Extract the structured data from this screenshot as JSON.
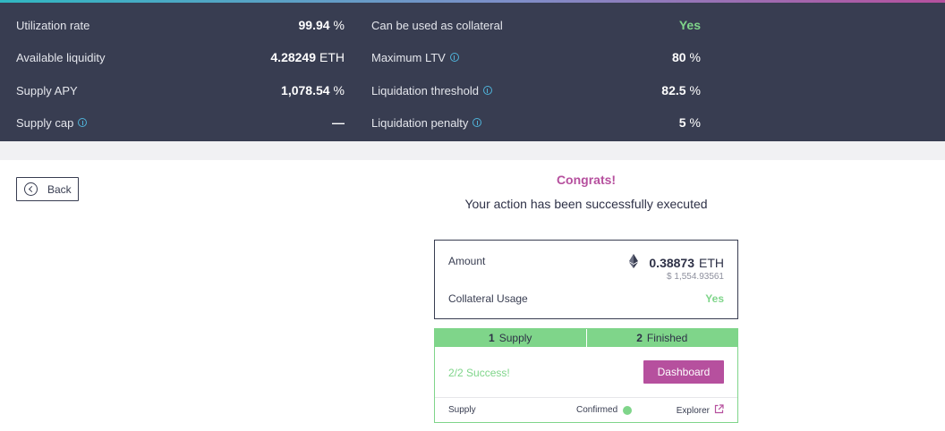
{
  "stats": {
    "left": [
      {
        "label": "Utilization rate",
        "value": "99.94",
        "unit": "%"
      },
      {
        "label": "Available liquidity",
        "value": "4.28249",
        "unit": "ETH"
      },
      {
        "label": "Supply APY",
        "value": "1,078.54",
        "unit": "%"
      },
      {
        "label": "Supply cap",
        "value": "—",
        "unit": ""
      }
    ],
    "right": [
      {
        "label": "Can be used as collateral",
        "value": "Yes"
      },
      {
        "label": "Maximum LTV",
        "value": "80",
        "unit": "%"
      },
      {
        "label": "Liquidation threshold",
        "value": "82.5",
        "unit": "%"
      },
      {
        "label": "Liquidation penalty",
        "value": "5",
        "unit": "%"
      }
    ]
  },
  "back_label": "Back",
  "result": {
    "title": "Congrats!",
    "subtitle": "Your action has been successfully executed"
  },
  "amount_box": {
    "amount_label": "Amount",
    "amount": "0.38873",
    "amount_unit": "ETH",
    "usd_value": "$ 1,554.93561",
    "collateral_label": "Collateral Usage",
    "collateral_value": "Yes"
  },
  "steps": {
    "items": [
      {
        "num": "1",
        "label": "Supply"
      },
      {
        "num": "2",
        "label": "Finished"
      }
    ],
    "success_text": "2/2 Success!",
    "dashboard_label": "Dashboard",
    "footer": {
      "action": "Supply",
      "status": "Confirmed",
      "explorer": "Explorer"
    }
  },
  "colors": {
    "accent": "#b6509e",
    "success": "#7fd58a",
    "panel": "#383d51",
    "info": "#4fb3d9"
  },
  "icons": {
    "back": "back-arrow-icon",
    "info": "info-icon",
    "token": "eth-icon",
    "status": "confirmed-dot-icon",
    "explorer": "external-link-icon"
  }
}
